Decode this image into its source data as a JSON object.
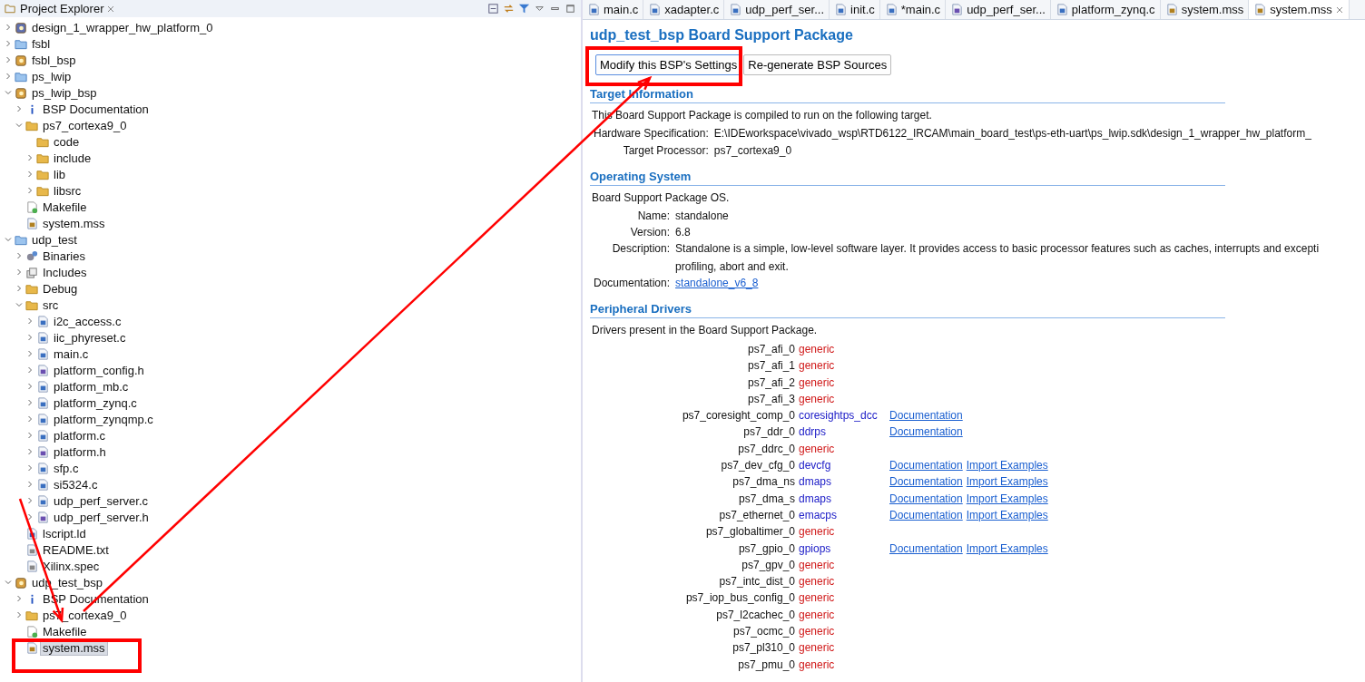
{
  "explorer": {
    "title": "Project Explorer",
    "tree": [
      {
        "label": "design_1_wrapper_hw_platform_0",
        "kind": "hw",
        "expanded": false,
        "selected": false
      },
      {
        "label": "fsbl",
        "kind": "project",
        "expanded": false,
        "selected": false
      },
      {
        "label": "fsbl_bsp",
        "kind": "bsp",
        "expanded": false,
        "selected": false
      },
      {
        "label": "ps_lwip",
        "kind": "project",
        "expanded": false,
        "selected": false
      },
      {
        "label": "ps_lwip_bsp",
        "kind": "bsp",
        "expanded": true,
        "selected": false,
        "children": [
          {
            "label": "BSP Documentation",
            "kind": "info",
            "expanded": false,
            "selected": false
          },
          {
            "label": "ps7_cortexa9_0",
            "kind": "folder",
            "expanded": true,
            "selected": false,
            "children": [
              {
                "label": "code",
                "kind": "folder",
                "selected": false
              },
              {
                "label": "include",
                "kind": "folder",
                "expanded": false,
                "selected": false
              },
              {
                "label": "lib",
                "kind": "folder",
                "expanded": false,
                "selected": false
              },
              {
                "label": "libsrc",
                "kind": "folder",
                "expanded": false,
                "selected": false
              }
            ]
          },
          {
            "label": "Makefile",
            "kind": "makefile",
            "selected": false
          },
          {
            "label": "system.mss",
            "kind": "mss",
            "selected": false
          }
        ]
      },
      {
        "label": "udp_test",
        "kind": "project",
        "expanded": true,
        "selected": false,
        "children": [
          {
            "label": "Binaries",
            "kind": "binaries",
            "expanded": false,
            "selected": false
          },
          {
            "label": "Includes",
            "kind": "includes",
            "expanded": false,
            "selected": false
          },
          {
            "label": "Debug",
            "kind": "folder",
            "expanded": false,
            "selected": false
          },
          {
            "label": "src",
            "kind": "folder",
            "expanded": true,
            "selected": false,
            "children": [
              {
                "label": "i2c_access.c",
                "kind": "c",
                "expanded": false,
                "selected": false
              },
              {
                "label": "iic_phyreset.c",
                "kind": "c",
                "expanded": false,
                "selected": false
              },
              {
                "label": "main.c",
                "kind": "c",
                "expanded": false,
                "selected": false
              },
              {
                "label": "platform_config.h",
                "kind": "h",
                "expanded": false,
                "selected": false
              },
              {
                "label": "platform_mb.c",
                "kind": "c",
                "expanded": false,
                "selected": false
              },
              {
                "label": "platform_zynq.c",
                "kind": "c",
                "expanded": false,
                "selected": false
              },
              {
                "label": "platform_zynqmp.c",
                "kind": "c",
                "expanded": false,
                "selected": false
              },
              {
                "label": "platform.c",
                "kind": "c",
                "expanded": false,
                "selected": false
              },
              {
                "label": "platform.h",
                "kind": "h",
                "expanded": false,
                "selected": false
              },
              {
                "label": "sfp.c",
                "kind": "c",
                "expanded": false,
                "selected": false
              },
              {
                "label": "si5324.c",
                "kind": "c",
                "expanded": false,
                "selected": false
              },
              {
                "label": "udp_perf_server.c",
                "kind": "c",
                "expanded": false,
                "selected": false
              },
              {
                "label": "udp_perf_server.h",
                "kind": "h",
                "expanded": false,
                "selected": false
              }
            ]
          },
          {
            "label": "lscript.ld",
            "kind": "linker",
            "selected": false
          },
          {
            "label": "README.txt",
            "kind": "text",
            "selected": false
          },
          {
            "label": "Xilinx.spec",
            "kind": "text",
            "selected": false
          }
        ]
      },
      {
        "label": "udp_test_bsp",
        "kind": "bsp",
        "expanded": true,
        "selected": false,
        "children": [
          {
            "label": "BSP Documentation",
            "kind": "info",
            "expanded": false,
            "selected": false
          },
          {
            "label": "ps7_cortexa9_0",
            "kind": "folder",
            "expanded": false,
            "selected": false
          },
          {
            "label": "Makefile",
            "kind": "makefile",
            "selected": false
          },
          {
            "label": "system.mss",
            "kind": "mss",
            "selected": true
          }
        ]
      }
    ]
  },
  "editor": {
    "tabs": [
      {
        "label": "main.c",
        "kind": "c",
        "selected": false
      },
      {
        "label": "xadapter.c",
        "kind": "c",
        "selected": false
      },
      {
        "label": "udp_perf_ser...",
        "kind": "c",
        "selected": false
      },
      {
        "label": "init.c",
        "kind": "c",
        "selected": false
      },
      {
        "label": "*main.c",
        "kind": "c",
        "selected": false
      },
      {
        "label": "udp_perf_ser...",
        "kind": "h",
        "selected": false
      },
      {
        "label": "platform_zynq.c",
        "kind": "c",
        "selected": false
      },
      {
        "label": "system.mss",
        "kind": "mss",
        "selected": false
      },
      {
        "label": "system.mss",
        "kind": "mss",
        "selected": true
      }
    ],
    "title": "udp_test_bsp Board Support Package",
    "buttons": [
      "Modify this BSP's Settings",
      "Re-generate BSP Sources"
    ],
    "target": {
      "heading": "Target Information",
      "intro": "This Board Support Package is compiled to run on the following target.",
      "fields": [
        {
          "label": "Hardware Specification:",
          "value": "E:\\IDEworkspace\\vivado_wsp\\RTD6122_IRCAM\\main_board_test\\ps-eth-uart\\ps_lwip.sdk\\design_1_wrapper_hw_platform_"
        },
        {
          "label": "Target Processor:",
          "value": "ps7_cortexa9_0"
        }
      ]
    },
    "os": {
      "heading": "Operating System",
      "intro": "Board Support Package OS.",
      "fields": [
        {
          "label": "Name:",
          "value": "standalone"
        },
        {
          "label": "Version:",
          "value": "6.8"
        },
        {
          "label": "Description:",
          "value": "Standalone is a simple, low-level software layer. It provides access to basic processor features such as caches, interrupts and excepti",
          "value_2": "profiling, abort and exit."
        }
      ],
      "doc_label": "Documentation:",
      "doc_link": "standalone_v6_8"
    },
    "drivers": {
      "heading": "Peripheral Drivers",
      "intro": "Drivers present in the Board Support Package.",
      "rows": [
        {
          "name": "ps7_afi_0",
          "driver": "generic",
          "generic": true,
          "links": []
        },
        {
          "name": "ps7_afi_1",
          "driver": "generic",
          "generic": true,
          "links": []
        },
        {
          "name": "ps7_afi_2",
          "driver": "generic",
          "generic": true,
          "links": []
        },
        {
          "name": "ps7_afi_3",
          "driver": "generic",
          "generic": true,
          "links": []
        },
        {
          "name": "ps7_coresight_comp_0",
          "driver": "coresightps_dcc",
          "generic": false,
          "links": [
            "Documentation"
          ]
        },
        {
          "name": "ps7_ddr_0",
          "driver": "ddrps",
          "generic": false,
          "links": [
            "Documentation"
          ]
        },
        {
          "name": "ps7_ddrc_0",
          "driver": "generic",
          "generic": true,
          "links": []
        },
        {
          "name": "ps7_dev_cfg_0",
          "driver": "devcfg",
          "generic": false,
          "links": [
            "Documentation",
            "Import Examples"
          ]
        },
        {
          "name": "ps7_dma_ns",
          "driver": "dmaps",
          "generic": false,
          "links": [
            "Documentation",
            "Import Examples"
          ]
        },
        {
          "name": "ps7_dma_s",
          "driver": "dmaps",
          "generic": false,
          "links": [
            "Documentation",
            "Import Examples"
          ]
        },
        {
          "name": "ps7_ethernet_0",
          "driver": "emacps",
          "generic": false,
          "links": [
            "Documentation",
            "Import Examples"
          ]
        },
        {
          "name": "ps7_globaltimer_0",
          "driver": "generic",
          "generic": true,
          "links": []
        },
        {
          "name": "ps7_gpio_0",
          "driver": "gpiops",
          "generic": false,
          "links": [
            "Documentation",
            "Import Examples"
          ]
        },
        {
          "name": "ps7_gpv_0",
          "driver": "generic",
          "generic": true,
          "links": []
        },
        {
          "name": "ps7_intc_dist_0",
          "driver": "generic",
          "generic": true,
          "links": []
        },
        {
          "name": "ps7_iop_bus_config_0",
          "driver": "generic",
          "generic": true,
          "links": []
        },
        {
          "name": "ps7_l2cachec_0",
          "driver": "generic",
          "generic": true,
          "links": []
        },
        {
          "name": "ps7_ocmc_0",
          "driver": "generic",
          "generic": true,
          "links": []
        },
        {
          "name": "ps7_pl310_0",
          "driver": "generic",
          "generic": true,
          "links": []
        },
        {
          "name": "ps7_pmu_0",
          "driver": "generic",
          "generic": true,
          "links": []
        }
      ]
    }
  },
  "annotations": [
    {
      "kind": "box"
    },
    {
      "kind": "box"
    },
    {
      "kind": "arrow"
    },
    {
      "kind": "arrow"
    }
  ]
}
